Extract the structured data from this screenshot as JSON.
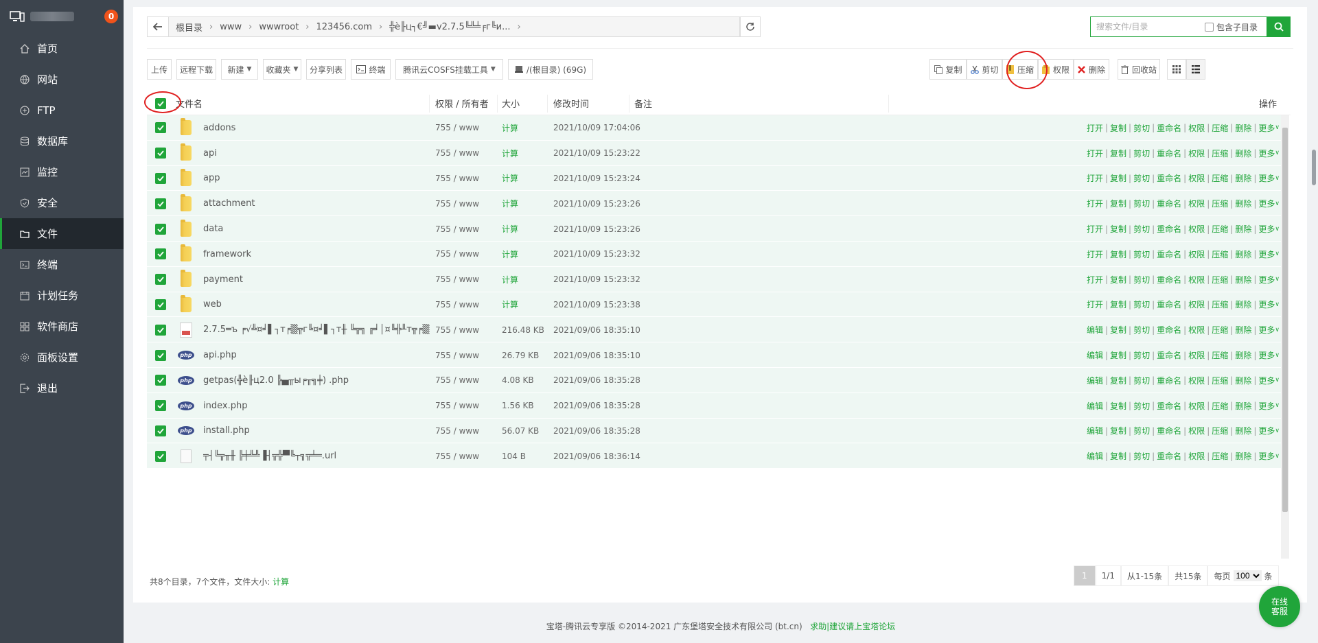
{
  "sidebar": {
    "badge": "0",
    "items": [
      {
        "label": "首页",
        "icon": "home-icon"
      },
      {
        "label": "网站",
        "icon": "globe-icon"
      },
      {
        "label": "FTP",
        "icon": "ftp-icon"
      },
      {
        "label": "数据库",
        "icon": "database-icon"
      },
      {
        "label": "监控",
        "icon": "monitor-icon"
      },
      {
        "label": "安全",
        "icon": "shield-icon"
      },
      {
        "label": "文件",
        "icon": "folder-icon",
        "active": true
      },
      {
        "label": "终端",
        "icon": "terminal-icon"
      },
      {
        "label": "计划任务",
        "icon": "calendar-icon"
      },
      {
        "label": "软件商店",
        "icon": "apps-icon"
      },
      {
        "label": "面板设置",
        "icon": "settings-icon"
      },
      {
        "label": "退出",
        "icon": "logout-icon"
      }
    ]
  },
  "breadcrumb": [
    "根目录",
    "www",
    "wwwroot",
    "123456.com",
    "╬ѐ╟ц┐€╝▬v2.7.5╚╩╧╒г╚и..."
  ],
  "search": {
    "placeholder": "搜索文件/目录",
    "include_sub": "包含子目录"
  },
  "toolbar": {
    "upload": "上传",
    "remote_download": "远程下载",
    "new": "新建",
    "favorites": "收藏夹",
    "share_list": "分享列表",
    "terminal": "终端",
    "cosfs": "腾讯云COSFS挂载工具",
    "disk": "/(根目录) (69G)",
    "copy": "复制",
    "cut": "剪切",
    "compress": "压缩",
    "permission": "权限",
    "delete": "删除",
    "recycle": "回收站"
  },
  "table": {
    "headers": {
      "name": "文件名",
      "perm": "权限 / 所有者",
      "size": "大小",
      "mtime": "修改时间",
      "remark": "备注",
      "ops": "操作"
    },
    "rows": [
      {
        "name": "addons",
        "type": "folder",
        "perm": "755 / www",
        "size": "计算",
        "mtime": "2021/10/09 17:04:06",
        "open": "打开"
      },
      {
        "name": "api",
        "type": "folder",
        "perm": "755 / www",
        "size": "计算",
        "mtime": "2021/10/09 15:23:22",
        "open": "打开"
      },
      {
        "name": "app",
        "type": "folder",
        "perm": "755 / www",
        "size": "计算",
        "mtime": "2021/10/09 15:23:24",
        "open": "打开"
      },
      {
        "name": "attachment",
        "type": "folder",
        "perm": "755 / www",
        "size": "计算",
        "mtime": "2021/10/09 15:23:26",
        "open": "打开"
      },
      {
        "name": "data",
        "type": "folder",
        "perm": "755 / www",
        "size": "计算",
        "mtime": "2021/10/09 15:23:26",
        "open": "打开"
      },
      {
        "name": "framework",
        "type": "folder",
        "perm": "755 / www",
        "size": "计算",
        "mtime": "2021/10/09 15:23:32",
        "open": "打开"
      },
      {
        "name": "payment",
        "type": "folder",
        "perm": "755 / www",
        "size": "计算",
        "mtime": "2021/10/09 15:23:32",
        "open": "打开"
      },
      {
        "name": "web",
        "type": "folder",
        "perm": "755 / www",
        "size": "计算",
        "mtime": "2021/10/09 15:23:38",
        "open": "打开"
      },
      {
        "name": "2.7.5═ъ ╒√╩¤╛▌┐т╒▒╦г╚¤╛▌┐т╫ ╚╦╗ ╔╛│¤╚╬╨т╦╒▒╚...",
        "type": "zip",
        "perm": "755 / www",
        "size": "216.48 KB",
        "mtime": "2021/09/06 18:35:10",
        "open": "编辑"
      },
      {
        "name": "api.php",
        "type": "php",
        "perm": "755 / www",
        "size": "26.79 KB",
        "mtime": "2021/09/06 18:35:10",
        "open": "编辑"
      },
      {
        "name": "getpas(╬ѐ╟ц2.0 ╠▄╥ы╒╥╗╪) .php",
        "type": "php",
        "perm": "755 / www",
        "size": "4.08 KB",
        "mtime": "2021/09/06 18:35:28",
        "open": "编辑"
      },
      {
        "name": "index.php",
        "type": "php",
        "perm": "755 / www",
        "size": "1.56 KB",
        "mtime": "2021/09/06 18:35:28",
        "open": "编辑"
      },
      {
        "name": "install.php",
        "type": "php",
        "perm": "755 / www",
        "size": "56.07 KB",
        "mtime": "2021/09/06 18:35:28",
        "open": "编辑"
      },
      {
        "name": "╤┤╚╦╥╫ ╠╪╩╩▐┤╦╬▀╚┬╗╦╧═.url",
        "type": "url",
        "perm": "755 / www",
        "size": "104 B",
        "mtime": "2021/09/06 18:36:14",
        "open": "编辑"
      }
    ],
    "ops": [
      "复制",
      "剪切",
      "重命名",
      "权限",
      "压缩",
      "删除",
      "更多"
    ]
  },
  "footer": {
    "summary": "共8个目录，7个文件，文件大小:",
    "calc": "计算",
    "page_current": "1",
    "page_of": "1/1",
    "range": "从1-15条",
    "total": "共15条",
    "per_page_label": "每页",
    "per_page": "100",
    "per_page_unit": "条"
  },
  "copyright": {
    "text": "宝塔-腾讯云专享版 ©2014-2021 广东堡塔安全技术有限公司 (bt.cn)",
    "link": "求助|建议请上宝塔论坛"
  },
  "online_service": [
    "在线",
    "客服"
  ],
  "colors": {
    "accent": "#20a53a",
    "sidebar": "#3c444d",
    "sidebar_active": "#22282e",
    "row": "#eef7f3",
    "highlight_ring": "#e02020"
  }
}
